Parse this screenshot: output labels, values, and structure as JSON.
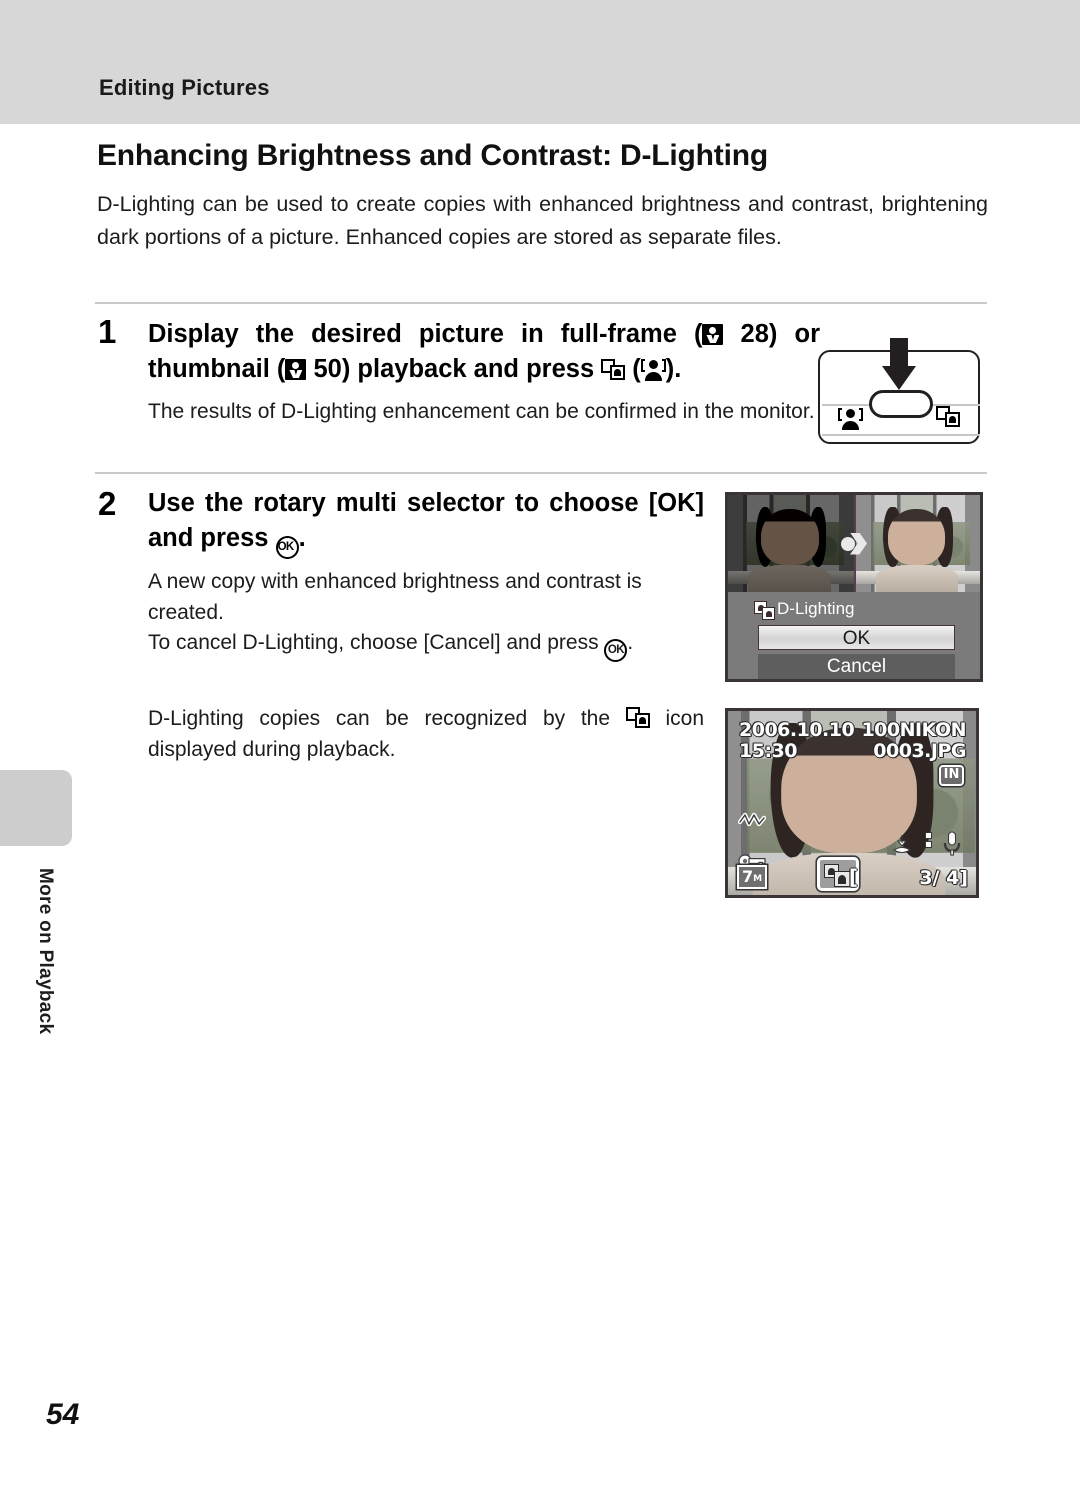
{
  "header": {
    "section_title": "Editing Pictures"
  },
  "main": {
    "heading": "Enhancing Brightness and Contrast: D-Lighting",
    "intro": "D-Lighting can be used to create copies with enhanced brightness and contrast, brightening dark portions of a picture. Enhanced copies are stored as separate files."
  },
  "steps": [
    {
      "number": "1",
      "title_part1": "Display the desired picture in full-frame (",
      "ref_page_1": " 28) or thumbnail (",
      "ref_page_2": " 50) playback and press ",
      "title_tail": " (",
      "title_end": ").",
      "body": "The results of D-Lighting enhancement can be confirmed in the monitor."
    },
    {
      "number": "2",
      "title_part1": "Use the rotary multi selector to choose [OK] and press ",
      "title_end": ".",
      "body_1": "A new copy with enhanced brightness and contrast is created.",
      "body_2a": "To cancel D-Lighting, choose [Cancel] and press ",
      "body_2b": ".",
      "body_3a": "D-Lighting copies can be recognized by the ",
      "body_3b": " icon displayed during playback."
    }
  ],
  "dlighting_screen": {
    "title": "D-Lighting",
    "button_ok": "OK",
    "button_cancel": "Cancel"
  },
  "playback_screen": {
    "date": "2006.10.10",
    "time": "15:30",
    "folder": "100NIKON",
    "filename": "0003.JPG",
    "memory_badge": "IN",
    "image_size_badge": "7",
    "image_size_unit": "M",
    "frame_counter_open": "[",
    "frame_counter": "3/  4]"
  },
  "chapter_tab": {
    "label": "More on Playback"
  },
  "footer": {
    "page_number": "54"
  },
  "colors": {
    "header_band": "#d7d7d7",
    "chapter_tab": "#cdcdcd",
    "rule": "#c9c9c9",
    "dialog_bg": "#7b7b7b",
    "dialog_cancel_bg": "#5e5e5e"
  }
}
